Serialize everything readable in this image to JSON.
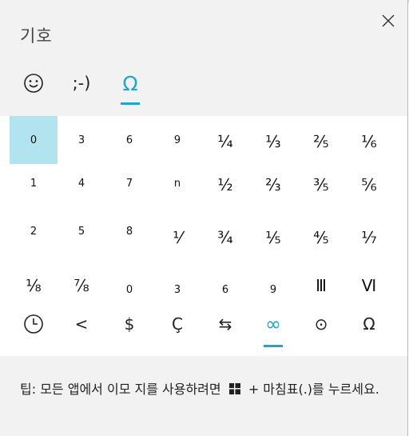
{
  "header": {
    "title": "기호",
    "close_icon": "close-icon"
  },
  "category_tabs": [
    {
      "label": "☺",
      "icon": "smiley-emoji-icon",
      "active": false
    },
    {
      "label": ";-)",
      "icon": "kaomoji-tab",
      "active": false
    },
    {
      "label": "Ω",
      "icon": "symbols-omega-icon",
      "active": true
    }
  ],
  "symbol_grid": {
    "selected_index": 0,
    "rows": [
      [
        "0",
        "3",
        "6",
        "9",
        "¼",
        "⅓",
        "⅖",
        "⅙"
      ],
      [
        "1",
        "4",
        "7",
        "n",
        "½",
        "⅔",
        "⅗",
        "⅚"
      ],
      [
        "2",
        "5",
        "8",
        "⅟",
        "¾",
        "⅕",
        "⅘",
        "⅐"
      ],
      [
        "⅛",
        "⅞",
        "0",
        "3",
        "6",
        "9",
        "Ⅲ",
        "Ⅵ"
      ]
    ]
  },
  "symbol_categories": [
    {
      "label": "",
      "icon": "clock-icon",
      "active": false
    },
    {
      "label": "<",
      "icon": "less-than-icon",
      "active": false
    },
    {
      "label": "$",
      "icon": "currency-icon",
      "active": false
    },
    {
      "label": "Ç",
      "icon": "latin-symbols-icon",
      "active": false
    },
    {
      "label": "⇆",
      "icon": "arrows-icon",
      "active": false
    },
    {
      "label": "∞",
      "icon": "infinity-icon",
      "active": true
    },
    {
      "label": "⊙",
      "icon": "circled-dot-icon",
      "active": false
    },
    {
      "label": "Ω",
      "icon": "omega-icon",
      "active": false
    }
  ],
  "footer": {
    "tip_before": "팁: 모든 앱에서 이모 지를 사용하려면",
    "tip_after": "+ 마침표(.)를 누르세요.",
    "windows_icon": "windows-logo-icon"
  },
  "colors": {
    "accent": "#1ea7c7",
    "selected_bg": "#b2e4ef",
    "panel_bg": "#f2f2f2"
  }
}
